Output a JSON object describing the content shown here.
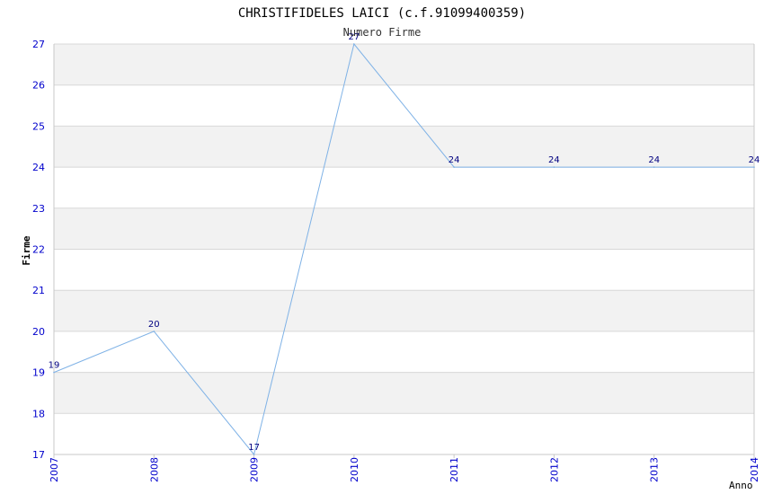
{
  "chart_data": {
    "type": "line",
    "title": "CHRISTIFIDELES LAICI (c.f.91099400359)",
    "subtitle": "Numero Firme",
    "xlabel": "Anno",
    "ylabel": "Firme",
    "x": [
      "2007",
      "2008",
      "2009",
      "2010",
      "2011",
      "2012",
      "2013",
      "2014"
    ],
    "series": [
      {
        "values": [
          19,
          20,
          17,
          27,
          24,
          24,
          24,
          24
        ]
      }
    ],
    "ylim": [
      17,
      27
    ],
    "yticks": [
      "17",
      "18",
      "19",
      "20",
      "21",
      "22",
      "23",
      "24",
      "25",
      "26",
      "27"
    ],
    "grid": true,
    "legend": "none",
    "colors": {
      "line": "#7fb2e6",
      "tick_label": "#0000cc",
      "data_label": "#000080",
      "title": "#000000",
      "band_light": "#f2f2f2",
      "band_white": "#ffffff",
      "grid": "#d8d8d8",
      "axis": "#c8c8c8"
    }
  }
}
